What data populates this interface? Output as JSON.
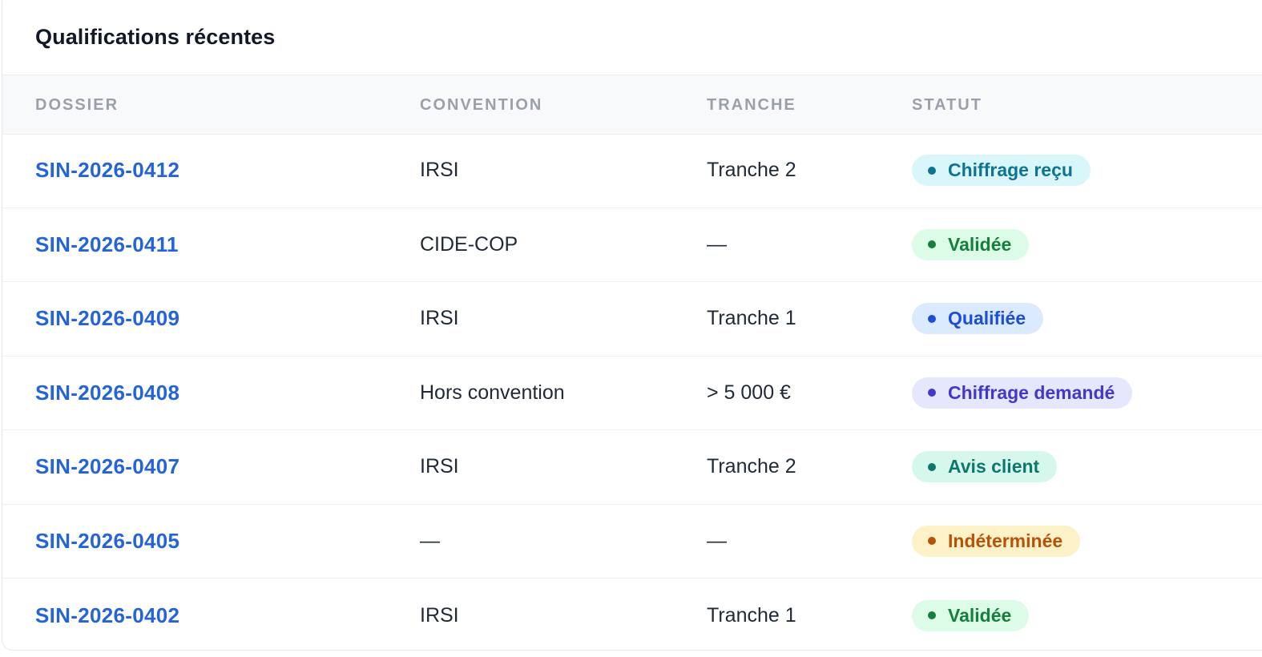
{
  "title": "Qualifications récentes",
  "columns": [
    "DOSSIER",
    "CONVENTION",
    "TRANCHE",
    "STATUT"
  ],
  "rows": [
    {
      "dossier": "SIN-2026-0412",
      "convention": "IRSI",
      "tranche": "Tranche 2",
      "statut": "Chiffrage reçu",
      "badge_bg": "#d9f7fb",
      "badge_fg": "#0e7490"
    },
    {
      "dossier": "SIN-2026-0411",
      "convention": "CIDE-COP",
      "tranche": "—",
      "statut": "Validée",
      "badge_bg": "#dcfce7",
      "badge_fg": "#15803d"
    },
    {
      "dossier": "SIN-2026-0409",
      "convention": "IRSI",
      "tranche": "Tranche 1",
      "statut": "Qualifiée",
      "badge_bg": "#dbeafe",
      "badge_fg": "#1d4ed8"
    },
    {
      "dossier": "SIN-2026-0408",
      "convention": "Hors convention",
      "tranche": "> 5 000 €",
      "statut": "Chiffrage demandé",
      "badge_bg": "#e5e7fd",
      "badge_fg": "#4338ca"
    },
    {
      "dossier": "SIN-2026-0407",
      "convention": "IRSI",
      "tranche": "Tranche 2",
      "statut": "Avis client",
      "badge_bg": "#d6f8ec",
      "badge_fg": "#0f766e"
    },
    {
      "dossier": "SIN-2026-0405",
      "convention": "—",
      "tranche": "—",
      "statut": "Indéterminée",
      "badge_bg": "#fdf1c7",
      "badge_fg": "#b45309"
    },
    {
      "dossier": "SIN-2026-0402",
      "convention": "IRSI",
      "tranche": "Tranche 1",
      "statut": "Validée",
      "badge_bg": "#dcfce7",
      "badge_fg": "#15803d"
    }
  ]
}
